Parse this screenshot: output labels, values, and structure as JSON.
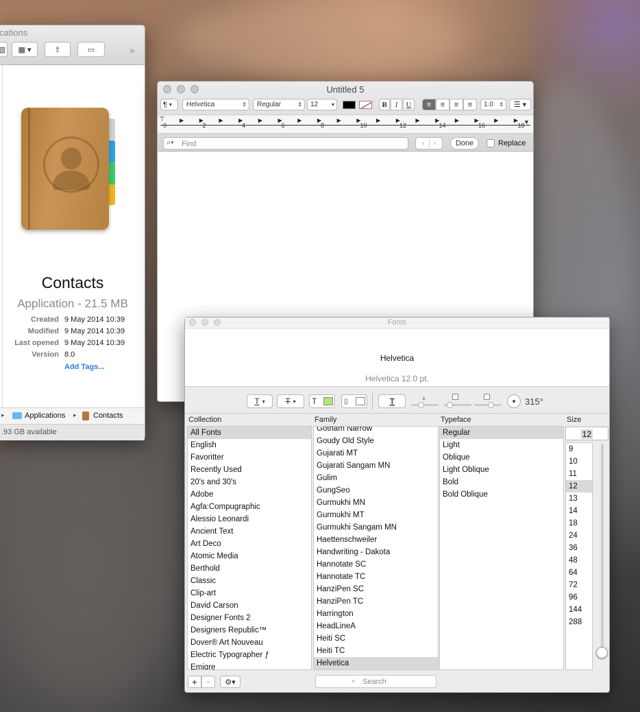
{
  "finder": {
    "title": "cations",
    "app_name": "Contacts",
    "app_kind": "Application - 21.5 MB",
    "meta": [
      {
        "k": "Created",
        "v": "9 May 2014 10:39"
      },
      {
        "k": "Modified",
        "v": "9 May 2014 10:39"
      },
      {
        "k": "Last opened",
        "v": "9 May 2014 10:39"
      },
      {
        "k": "Version",
        "v": "8.0"
      }
    ],
    "add_tags": "Add Tags...",
    "path": [
      "Applications",
      "Contacts"
    ],
    "status": ".93 GB available",
    "more": "»"
  },
  "editor": {
    "title": "Untitled 5",
    "para_btn": "¶",
    "font": "Helvetica",
    "style": "Regular",
    "size": "12",
    "bold": "B",
    "italic": "I",
    "underline": "U",
    "line_spacing": "1.0",
    "ruler": [
      "0",
      "2",
      "4",
      "6",
      "8",
      "10",
      "12",
      "14",
      "16",
      "18"
    ],
    "find_placeholder": "Find",
    "done": "Done",
    "replace": "Replace"
  },
  "fonts": {
    "title": "Fonts",
    "preview": "Helvetica",
    "preview_info": "Helvetica 12.0 pt.",
    "angle": "315°",
    "headers": {
      "collection": "Collection",
      "family": "Family",
      "typeface": "Typeface",
      "size": "Size"
    },
    "collections": [
      "All Fonts",
      "English",
      "Favoritter",
      "Recently Used",
      "20's and 30's",
      "Adobe",
      "Agfa:Compugraphic",
      "Alessio Leonardi",
      "Ancient Text",
      "Art Deco",
      "Atomic Media",
      "Berthold",
      "Classic",
      "Clip-art",
      "David Carson",
      "Designer Fonts 2",
      "Designers Republic™",
      "Dover® Art Nouveau",
      "Electric Typographer ƒ",
      "Emigre"
    ],
    "families": [
      "Gotham Narrow",
      "Goudy Old Style",
      "Gujarati MT",
      "Gujarati Sangam MN",
      "Gulim",
      "GungSeo",
      "Gurmukhi MN",
      "Gurmukhi MT",
      "Gurmukhi Sangam MN",
      "Haettenschweiler",
      "Handwriting - Dakota",
      "Hannotate SC",
      "Hannotate TC",
      "HanziPen SC",
      "HanziPen TC",
      "Harrington",
      "HeadLineA",
      "Heiti SC",
      "Heiti TC",
      "Helvetica"
    ],
    "typefaces": [
      "Regular",
      "Light",
      "Oblique",
      "Light Oblique",
      "Bold",
      "Bold Oblique"
    ],
    "size_value": "12",
    "sizes": [
      "9",
      "10",
      "11",
      "12",
      "13",
      "14",
      "18",
      "24",
      "36",
      "48",
      "64",
      "72",
      "96",
      "144",
      "288"
    ],
    "search_placeholder": "Search",
    "add": "+",
    "remove": "−"
  },
  "colors": {
    "selection": "#d9d9d9",
    "accent": "#2a7ee0",
    "tab_colors": [
      "#c8c8c8",
      "#2ea0e6",
      "#3cc86a",
      "#f4b41a"
    ]
  }
}
